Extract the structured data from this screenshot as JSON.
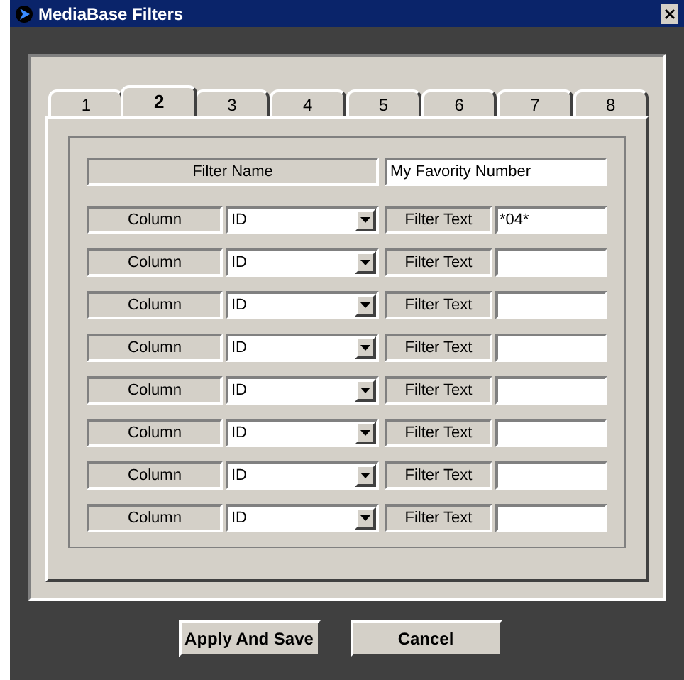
{
  "window": {
    "title": "MediaBase Filters"
  },
  "tabs": [
    {
      "label": "1",
      "selected": false
    },
    {
      "label": "2",
      "selected": true
    },
    {
      "label": "3",
      "selected": false
    },
    {
      "label": "4",
      "selected": false
    },
    {
      "label": "5",
      "selected": false
    },
    {
      "label": "6",
      "selected": false
    },
    {
      "label": "7",
      "selected": false
    },
    {
      "label": "8",
      "selected": false
    }
  ],
  "filter_name": {
    "label": "Filter Name",
    "value": "My Favority Number"
  },
  "filters": [
    {
      "column_label": "Column",
      "column_value": "ID",
      "text_label": "Filter Text",
      "text_value": "*04*"
    },
    {
      "column_label": "Column",
      "column_value": "ID",
      "text_label": "Filter Text"
    },
    {
      "column_label": "Column",
      "column_value": "ID",
      "text_label": "Filter Text"
    },
    {
      "column_label": "Column",
      "column_value": "ID",
      "text_label": "Filter Text"
    },
    {
      "column_label": "Column",
      "column_value": "ID",
      "text_label": "Filter Text"
    },
    {
      "column_label": "Column",
      "column_value": "ID",
      "text_label": "Filter Text"
    },
    {
      "column_label": "Column",
      "column_value": "ID",
      "text_label": "Filter Text"
    },
    {
      "column_label": "Column",
      "column_value": "ID",
      "text_label": "Filter Text"
    }
  ],
  "buttons": [
    "Apply And Save",
    "Cancel"
  ]
}
